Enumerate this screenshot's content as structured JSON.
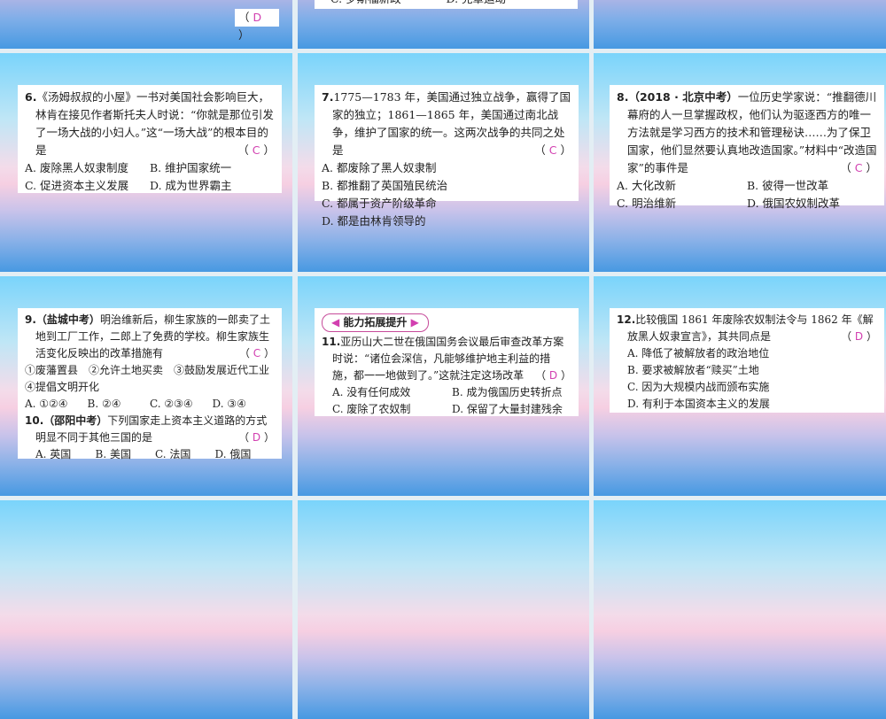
{
  "slide_top_left": {
    "answer": "D"
  },
  "slide_top_middle": {
    "options": [
      "C. 罗斯福新政",
      "D. 宪章运动"
    ]
  },
  "q6": {
    "number": "6.",
    "text": "《汤姆叔叔的小屋》一书对美国社会影响巨大，林肯在接见作者斯托夫人时说：“你就是那位引发了一场大战的小妇人。”这“一场大战”的根本目的是",
    "answer": "C",
    "options": [
      "A. 废除黑人奴隶制度",
      "B. 维护国家统一",
      "C. 促进资本主义发展",
      "D. 成为世界霸主"
    ]
  },
  "q7": {
    "number": "7.",
    "text": "1775—1783 年，美国通过独立战争，赢得了国家的独立；1861—1865 年，美国通过南北战争，维护了国家的统一。这两次战争的共同之处是",
    "answer": "C",
    "options": [
      "A. 都废除了黑人奴隶制",
      "B. 都推翻了英国殖民统治",
      "C. 都属于资产阶级革命",
      "D. 都是由林肯领导的"
    ]
  },
  "q8": {
    "number": "8.",
    "source": "（2018 · 北京中考）",
    "text": "一位历史学家说：“推翻德川幕府的人一旦掌握政权，他们认为驱逐西方的唯一方法就是学习西方的技术和管理秘诀……为了保卫国家，他们显然要认真地改造国家。”材料中“改造国家”的事件是",
    "answer": "C",
    "options": [
      "A. 大化改新",
      "B. 彼得一世改革",
      "C. 明治维新",
      "D. 俄国农奴制改革"
    ]
  },
  "q9": {
    "number": "9.",
    "source": "（盐城中考）",
    "text": "明治维新后，柳生家族的一郎卖了土地到工厂工作，二郎上了免费的学校。柳生家族生活变化反映出的改革措施有",
    "answer": "C",
    "items": "①废藩置县　②允许土地买卖　③鼓励发展近代工业　④提倡文明开化",
    "options": [
      "A. ①②④",
      "B. ②④",
      "C. ②③④",
      "D. ③④"
    ]
  },
  "q10": {
    "number": "10.",
    "source": "（邵阳中考）",
    "text": "下列国家走上资本主义道路的方式明显不同于其他三国的是",
    "answer": "D",
    "options": [
      "A. 英国",
      "B. 美国",
      "C. 法国",
      "D. 俄国"
    ]
  },
  "section_banner": "能力拓展提升",
  "q11": {
    "number": "11.",
    "text": "亚历山大二世在俄国国务会议最后审查改革方案时说：“诸位会深信，凡能够维护地主利益的措施，都一一地做到了。”这就注定这场改革",
    "answer": "D",
    "options": [
      "A. 没有任何成效",
      "B. 成为俄国历史转折点",
      "C. 废除了农奴制",
      "D. 保留了大量封建残余"
    ]
  },
  "q12": {
    "number": "12.",
    "text": "比较俄国 1861 年废除农奴制法令与 1862 年《解放黑人奴隶宣言》，其共同点是",
    "answer": "D",
    "options": [
      "A. 降低了被解放者的政治地位",
      "B. 要求被解放者“赎买”土地",
      "C. 因为大规模内战而颁布实施",
      "D. 有利于本国资本主义的发展"
    ]
  }
}
